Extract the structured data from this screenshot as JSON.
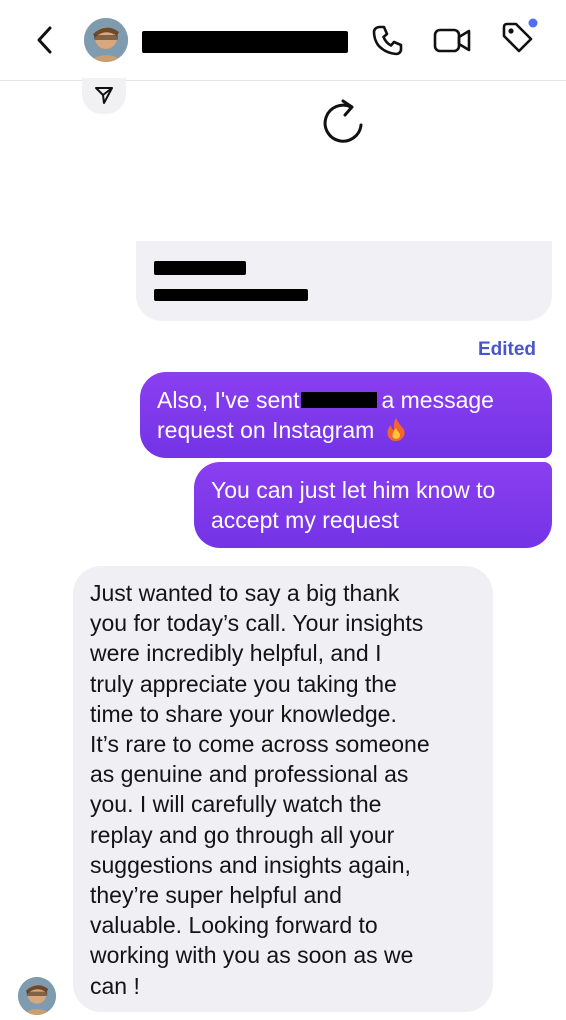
{
  "header": {
    "icons": [
      "chevron-left-icon",
      "avatar",
      "phone-icon",
      "video-camera-icon",
      "tag-icon"
    ],
    "notification_dot_color": "#4f6df5"
  },
  "status": {
    "edited": "Edited"
  },
  "messages": {
    "sent_1_line_1_before": "Also, I've sent",
    "sent_1_line_1_after": "a message",
    "sent_1_line_2": "request on Instagram",
    "sent_2_line_1": "You can just let him know to",
    "sent_2_line_2": "accept my request",
    "received_text": "Just wanted to say a big thank\nyou for today’s call. Your insights\nwere incredibly helpful, and I\ntruly appreciate you taking the\ntime to share your knowledge.\nIt’s rare to come across someone\nas genuine and professional as\nyou. I will carefully watch the\nreplay and go through all your\nsuggestions and insights again,\nthey’re super helpful and\nvaluable. Looking forward to\nworking with you as soon as we\ncan !"
  },
  "colors": {
    "sent_bubble": "#7f3aec",
    "received_bubble": "#efeff4",
    "edited_label": "#4a55c9"
  }
}
